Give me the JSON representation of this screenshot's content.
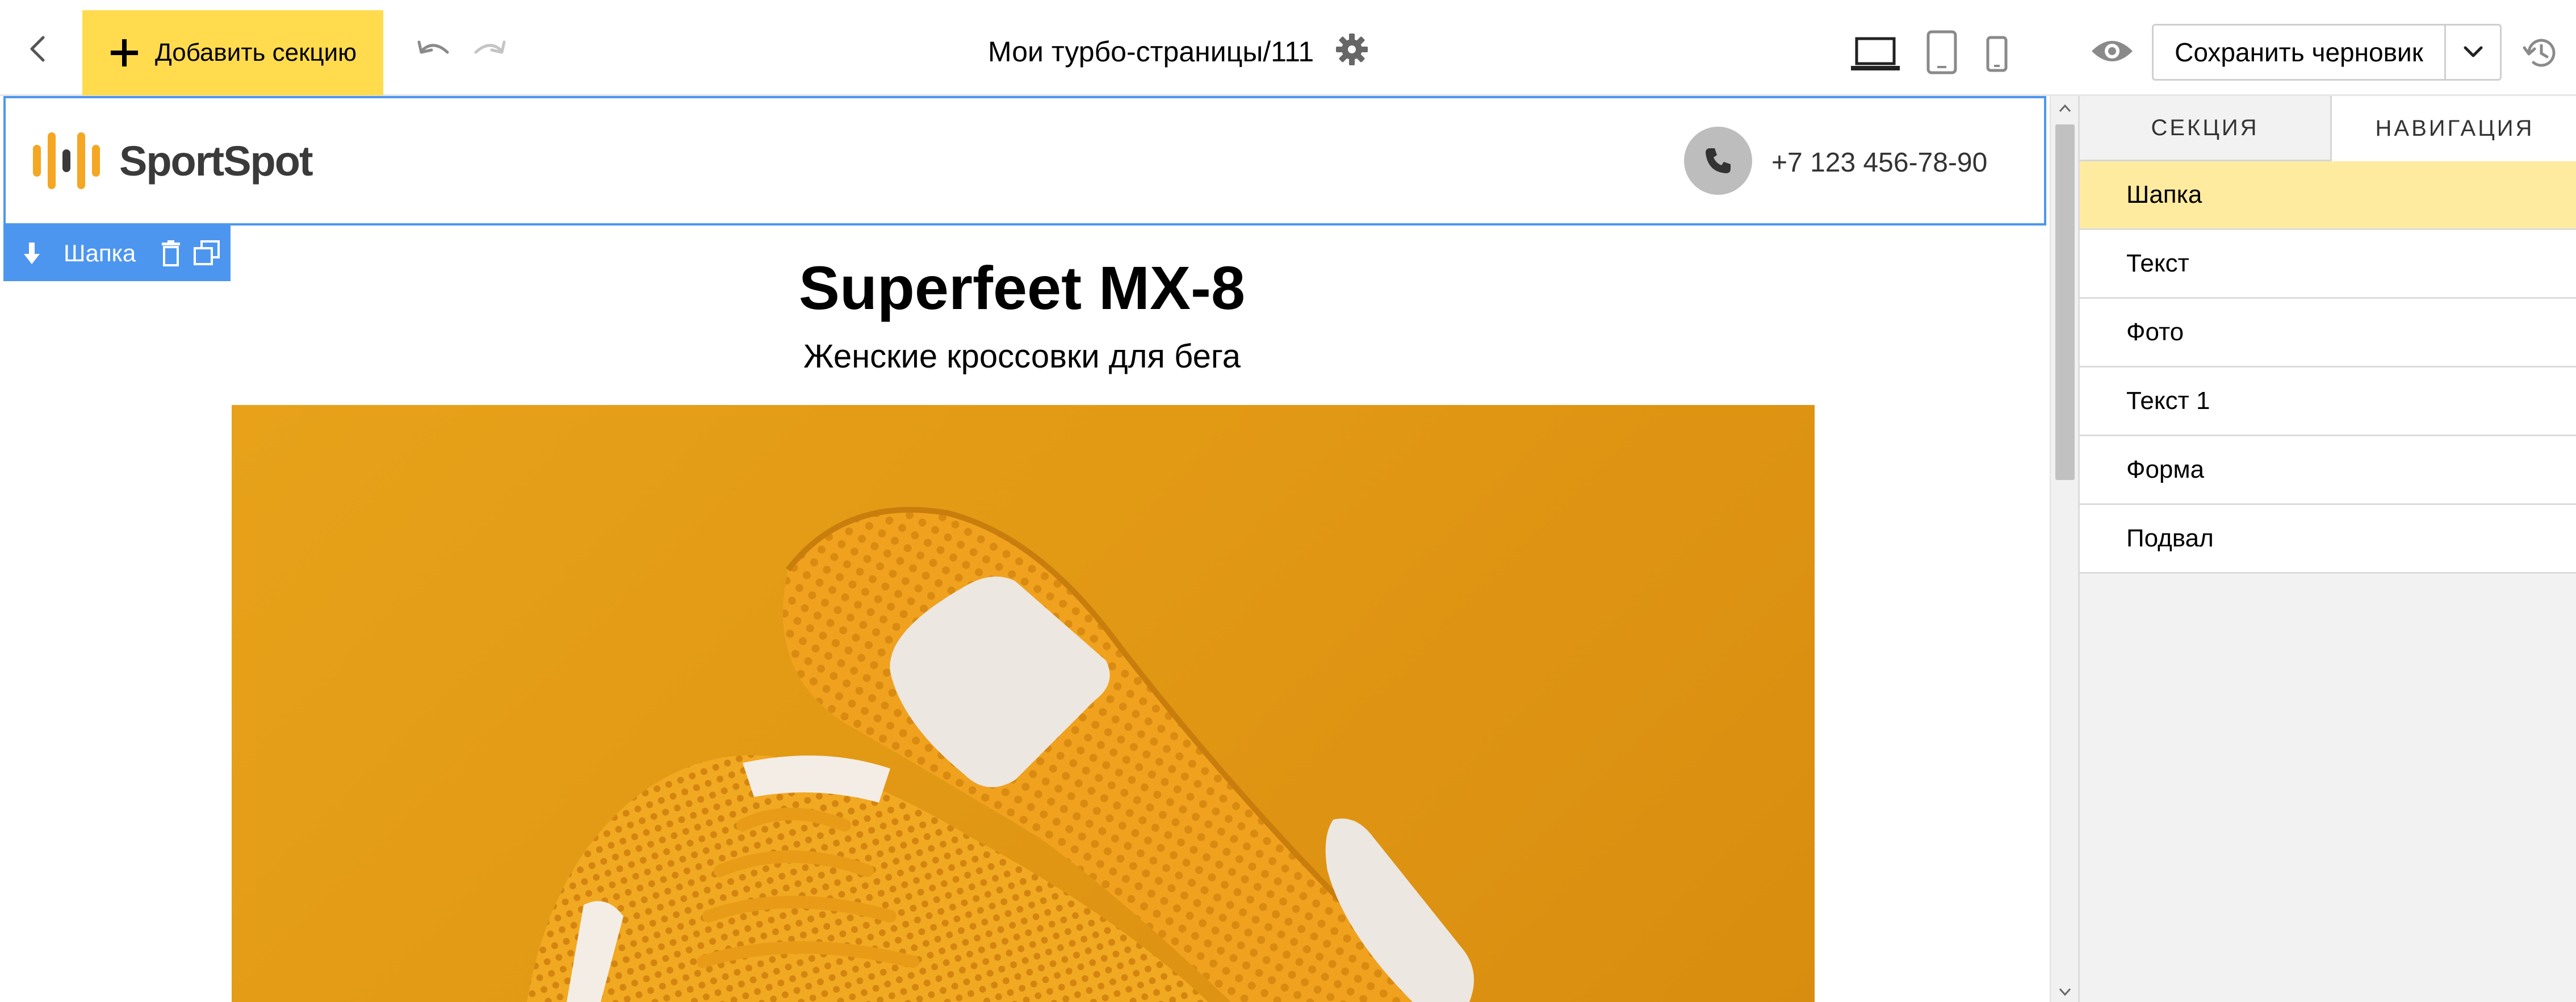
{
  "toolbar": {
    "add_section_label": "Добавить секцию",
    "page_title": "Мои турбо-страницы/111",
    "save_draft_label": "Сохранить черновик",
    "accent_color": "#ffdb4d"
  },
  "header_section": {
    "logo_text": "SportSpot",
    "phone": "+7 123 456-78-90",
    "logo_color": "#f5a623"
  },
  "section_label": {
    "name": "Шапка",
    "color": "#4d96ef"
  },
  "content": {
    "title": "Superfeet MX-8",
    "subtitle": "Женские кроссовки для бега"
  },
  "panel": {
    "tabs": [
      {
        "label": "СЕКЦИЯ",
        "active": false
      },
      {
        "label": "НАВИГАЦИЯ",
        "active": true
      }
    ],
    "items": [
      {
        "label": "Шапка",
        "active": true
      },
      {
        "label": "Текст",
        "active": false
      },
      {
        "label": "Фото",
        "active": false
      },
      {
        "label": "Текст 1",
        "active": false
      },
      {
        "label": "Форма",
        "active": false
      },
      {
        "label": "Подвал",
        "active": false
      }
    ],
    "active_color": "#ffeba0"
  }
}
